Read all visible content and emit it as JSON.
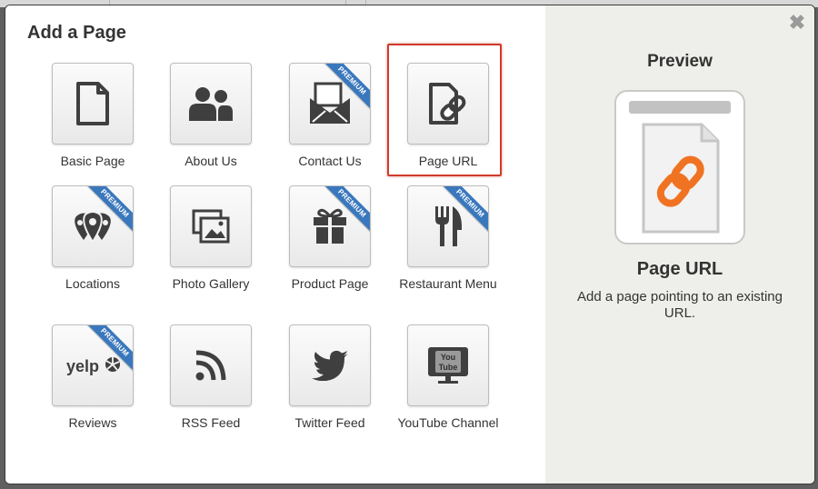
{
  "modal": {
    "title": "Add a Page",
    "close_icon": "close-icon",
    "close_symbol": "✖"
  },
  "tiles": [
    {
      "label": "Basic Page",
      "icon": "document-icon",
      "premium": false
    },
    {
      "label": "About Us",
      "icon": "people-icon",
      "premium": false
    },
    {
      "label": "Contact Us",
      "icon": "envelope-icon",
      "premium": true
    },
    {
      "label": "Page URL",
      "icon": "link-page-icon",
      "premium": false,
      "selected": true
    },
    {
      "label": "Locations",
      "icon": "map-pin-icon",
      "premium": true
    },
    {
      "label": "Photo Gallery",
      "icon": "photos-icon",
      "premium": false
    },
    {
      "label": "Product Page",
      "icon": "gift-icon",
      "premium": true
    },
    {
      "label": "Restaurant Menu",
      "icon": "fork-knife-icon",
      "premium": true
    },
    {
      "label": "Reviews",
      "icon": "yelp-icon",
      "premium": true
    },
    {
      "label": "RSS Feed",
      "icon": "rss-icon",
      "premium": false
    },
    {
      "label": "Twitter Feed",
      "icon": "twitter-bird-icon",
      "premium": false
    },
    {
      "label": "YouTube Channel",
      "icon": "youtube-tv-icon",
      "premium": false
    }
  ],
  "premium_badge": "PREMIUM",
  "yelp_text": "yelp",
  "youtube_text_top": "You",
  "youtube_text_bottom": "Tube",
  "preview": {
    "heading": "Preview",
    "title": "Page URL",
    "description": "Add a page pointing to an existing URL.",
    "accent_color": "#f07322"
  }
}
